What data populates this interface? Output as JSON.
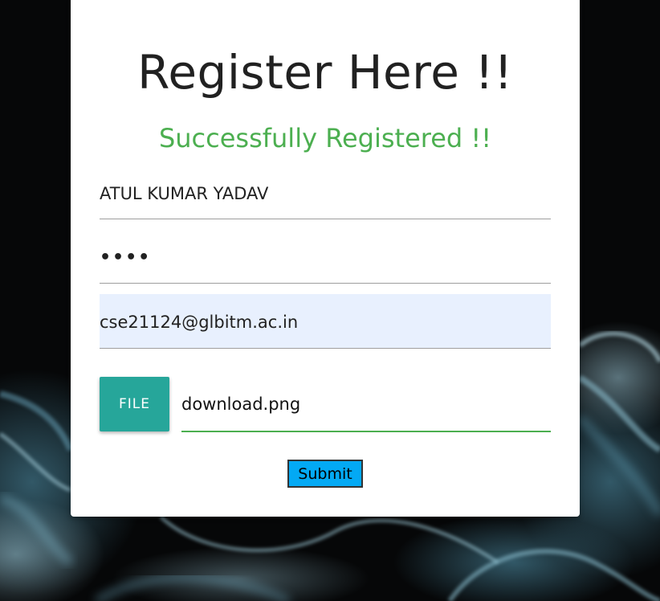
{
  "form": {
    "title": "Register Here !!",
    "success_message": "Successfully Registered !!",
    "name_value": "ATUL KUMAR YADAV",
    "password_value": "••••",
    "email_value": "cse21124@glbitm.ac.in",
    "file_button_label": "FILE",
    "file_name": "download.png",
    "submit_label": "Submit"
  },
  "colors": {
    "success": "#4caf50",
    "file_button": "#26a69a",
    "submit_button": "#03a9f4",
    "email_autofill_bg": "#e8f0fe"
  },
  "background": {
    "description_icon": "smoke-background-image"
  }
}
